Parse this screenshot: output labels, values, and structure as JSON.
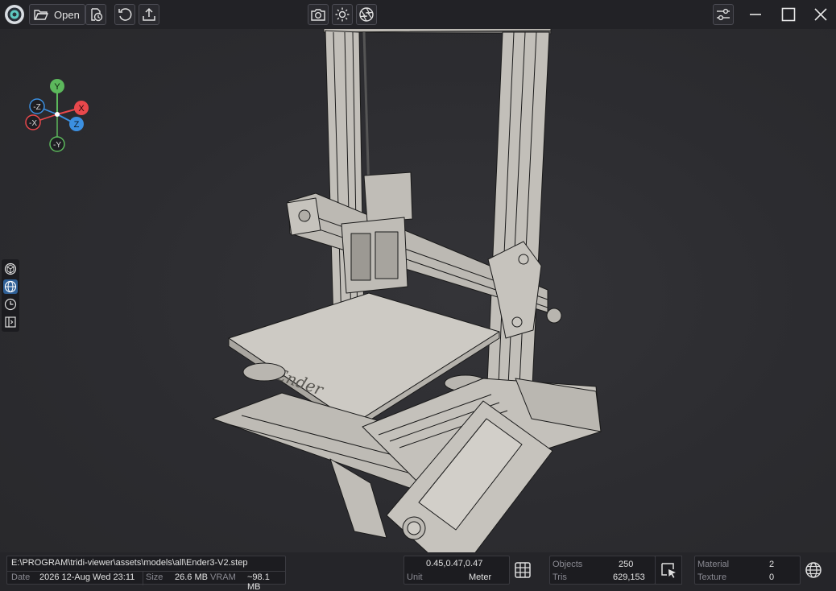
{
  "toolbar": {
    "logo_icon": "app-logo-icon",
    "open_label": "Open",
    "icons": [
      "folder-open-icon",
      "recent-files-icon",
      "reload-icon",
      "export-icon",
      "screenshot-icon",
      "light-icon",
      "aperture-icon",
      "settings-sliders-icon"
    ]
  },
  "window_controls": [
    "minimize-icon",
    "maximize-icon",
    "close-icon"
  ],
  "gizmo": {
    "x_pos": "X",
    "x_neg": "-X",
    "y_pos": "Y",
    "y_neg": "-Y",
    "z_pos": "Z",
    "z_neg": "-Z",
    "colors": {
      "x": "#e8484c",
      "y": "#5cb85c",
      "z": "#3b8fe0"
    }
  },
  "sidebar": {
    "items": [
      "wireframe-cube-icon",
      "globe-icon",
      "clock-icon",
      "panel-toggle-icon"
    ],
    "active_index": 1
  },
  "status": {
    "file_path": "E:\\PROGRAM\\tridi-viewer\\assets\\models\\all\\Ender3-V2.step",
    "date_label": "Date",
    "date_value": "2026 12-Aug Wed 23:11",
    "size_label": "Size",
    "size_value": "26.6 MB",
    "vram_label": "VRAM",
    "vram_value": "~98.1 MB",
    "coords_value": "0.45,0.47,0.47",
    "unit_label": "Unit",
    "unit_value": "Meter",
    "objects_label": "Objects",
    "objects_value": "250",
    "tris_label": "Tris",
    "tris_value": "629,153",
    "material_label": "Material",
    "material_value": "2",
    "texture_label": "Texture",
    "texture_value": "0"
  },
  "colors": {
    "accent": "#2e5f96",
    "model_fill": "#c9c6c0",
    "model_stroke": "#1a1a1a",
    "background": "#2c2c30"
  }
}
